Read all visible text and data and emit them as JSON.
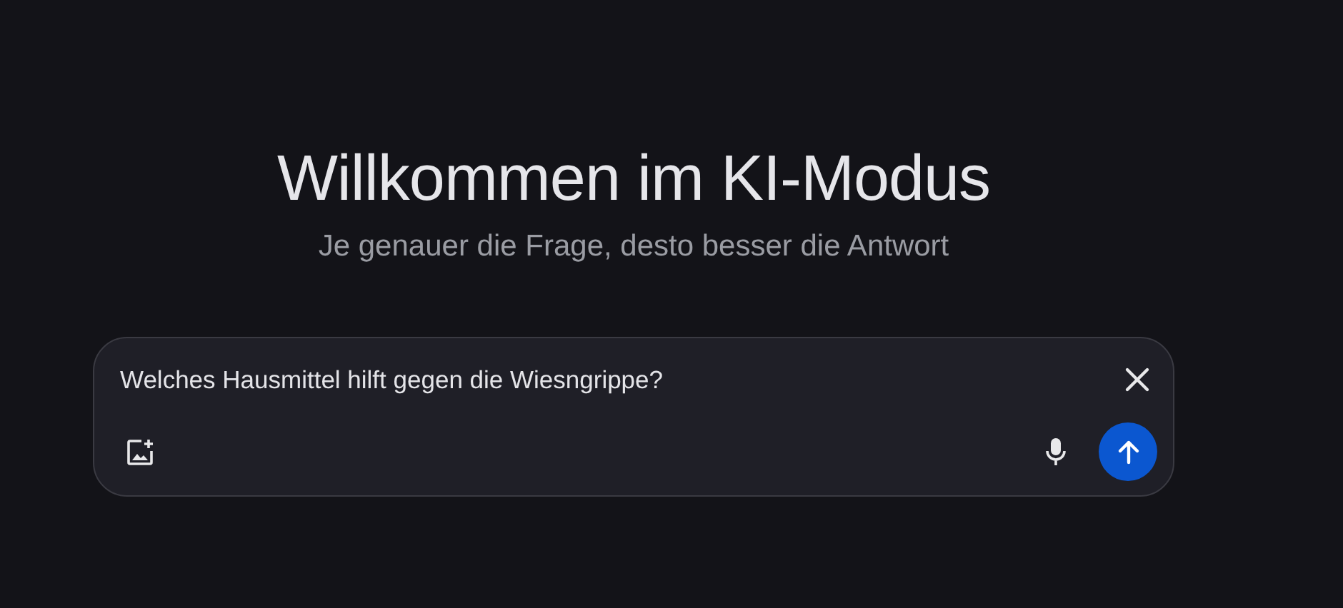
{
  "title": "Willkommen im KI-Modus",
  "subtitle": "Je genauer die Frage, desto besser die Antwort",
  "query": {
    "value": "Welches Hausmittel hilft gegen die Wiesngrippe?"
  }
}
